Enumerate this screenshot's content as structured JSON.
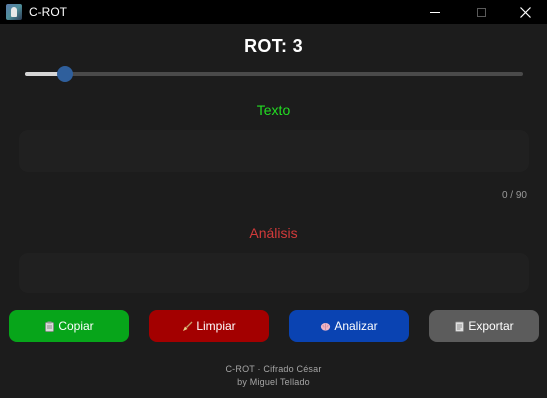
{
  "window": {
    "title": "C-ROT",
    "icon": "app-icon",
    "controls": [
      "minimize-icon",
      "maximize-icon",
      "close-icon"
    ]
  },
  "rot": {
    "title": "ROT: 3",
    "value": 3,
    "slider_fraction": 0.08
  },
  "texto": {
    "label": "Texto",
    "value": "",
    "counter": "0 / 90",
    "label_color": "#22dd22"
  },
  "analisis": {
    "label": "Análisis",
    "value": "",
    "label_color": "#d23a3a"
  },
  "buttons": [
    {
      "label": "Copiar",
      "icon": "clipboard-icon",
      "color": "#07a51a"
    },
    {
      "label": "Limpiar",
      "icon": "broom-icon",
      "color": "#a30000"
    },
    {
      "label": "Analizar",
      "icon": "brain-icon",
      "color": "#0a43b2"
    },
    {
      "label": "Exportar",
      "icon": "document-icon",
      "color": "#5c5c5c"
    }
  ],
  "footer": {
    "line1": "C-ROT · Cifrado César",
    "line2": "by Miguel Tellado"
  }
}
